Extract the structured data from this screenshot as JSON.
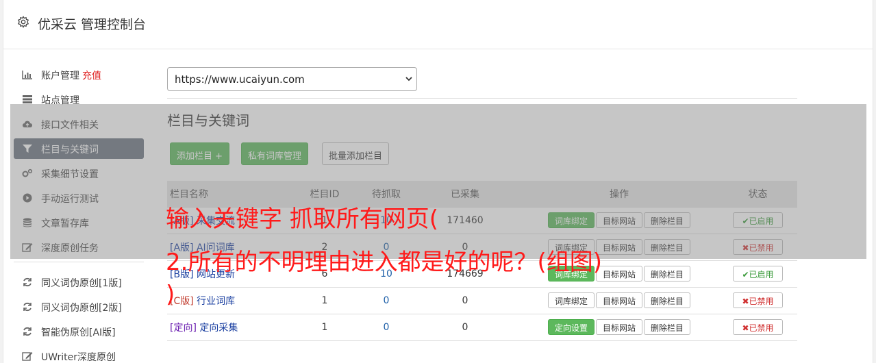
{
  "app": {
    "title": "优采云 管理控制台"
  },
  "sidebar": {
    "items": [
      {
        "label": "账户管理",
        "extra": "充值",
        "icon": "bar-chart-icon"
      },
      {
        "label": "站点管理",
        "icon": "server-icon"
      },
      {
        "label": "接口文件相关",
        "icon": "cloud-upload-icon"
      },
      {
        "label": "栏目与关键词",
        "icon": "filter-icon",
        "active": true
      },
      {
        "label": "采集细节设置",
        "icon": "gears-icon"
      },
      {
        "label": "手动运行测试",
        "icon": "play-icon"
      },
      {
        "label": "文章暂存库",
        "icon": "database-icon"
      },
      {
        "label": "深度原创任务",
        "icon": "edit-icon"
      }
    ],
    "items2": [
      {
        "label": "同义词伪原创[1版]",
        "icon": "refresh-icon"
      },
      {
        "label": "同义词伪原创[2版]",
        "icon": "refresh-icon"
      },
      {
        "label": "智能伪原创[AI版]",
        "icon": "refresh-icon"
      },
      {
        "label": "UWriter深度原创",
        "icon": "edit-icon"
      }
    ]
  },
  "site_select": {
    "value": "https://www.ucaiyun.com"
  },
  "section": {
    "title": "栏目与关键词"
  },
  "toolbar": {
    "add_label": "添加栏目 +",
    "private_label": "私有词库管理",
    "batch_label": "批量添加栏目"
  },
  "table": {
    "headers": [
      "栏目名称",
      "栏目ID",
      "待抓取",
      "已采集",
      "操作",
      "状态"
    ],
    "rows": [
      {
        "tag": "[A版]",
        "name": "采集交流",
        "id": "1",
        "pending": "10",
        "collected": "171460",
        "op1": "词库绑定",
        "op1_green": true,
        "op2": "目标网站",
        "op3": "删除栏目",
        "status": "✔已启用",
        "on": true
      },
      {
        "tag": "[A版]",
        "name": "AI问词库",
        "id": "2",
        "pending": "0",
        "collected": "0",
        "op1": "词库绑定",
        "op1_green": false,
        "op2": "目标网站",
        "op3": "删除栏目",
        "status": "✖已禁用",
        "on": false
      },
      {
        "tag": "[B版]",
        "name": "网站更新",
        "id": "6",
        "pending": "10",
        "collected": "174669",
        "op1": "词库绑定",
        "op1_green": true,
        "op2": "目标网站",
        "op3": "删除栏目",
        "status": "✔已启用",
        "on": true
      },
      {
        "tag": "[C版]",
        "name": "行业词库",
        "id": "1",
        "pending": "0",
        "collected": "0",
        "op1": "词库绑定",
        "op1_green": false,
        "op2": "目标网站",
        "op3": "删除栏目",
        "status": "✖已禁用",
        "on": false
      },
      {
        "tag": "[定向]",
        "name": "定向采集",
        "id": "1",
        "pending": "0",
        "collected": "0",
        "op1": "定向设置",
        "op1_green": true,
        "op2": "目标网站",
        "op3": "删除栏目",
        "status": "✖已禁用",
        "on": false
      }
    ]
  },
  "caption": {
    "line1": "输入关键字 抓取所有网页(",
    "line2": "2.所有的不明理由进入都是好的呢？(组图)",
    "line3": ")"
  },
  "colors": {
    "accent_green": "#5cb85c",
    "active_nav": "#6b7380",
    "caption_red": "#ff1a1a"
  }
}
